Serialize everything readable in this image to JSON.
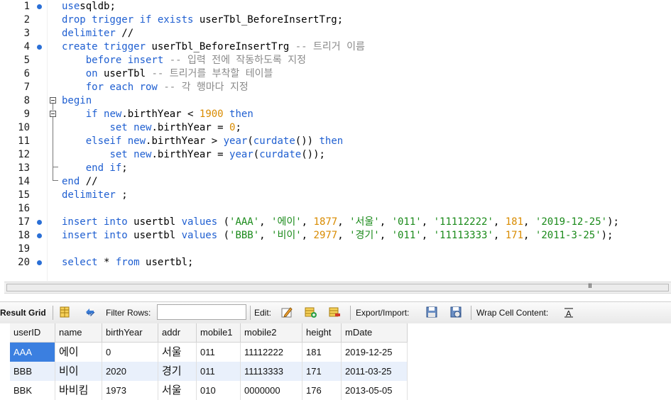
{
  "editor": {
    "lines": [
      {
        "n": "1",
        "bp": true,
        "tokens": [
          [
            "kw",
            "use"
          ],
          [
            "",
            "sqldb;"
          ]
        ]
      },
      {
        "n": "2",
        "bp": false,
        "tokens": [
          [
            "kw",
            "drop trigger if exists"
          ],
          [
            "",
            " userTbl_BeforeInsertTrg;"
          ]
        ]
      },
      {
        "n": "3",
        "bp": false,
        "tokens": [
          [
            "kw",
            "delimiter"
          ],
          [
            "",
            " //"
          ]
        ]
      },
      {
        "n": "4",
        "bp": true,
        "tokens": [
          [
            "kw",
            "create trigger"
          ],
          [
            "",
            " userTbl_BeforeInsertTrg "
          ],
          [
            "cm",
            "-- 트리거 이름"
          ]
        ]
      },
      {
        "n": "5",
        "bp": false,
        "tokens": [
          [
            "",
            "    "
          ],
          [
            "kw",
            "before insert"
          ],
          [
            "",
            " "
          ],
          [
            "cm",
            "-- 입력 전에 작동하도록 지정"
          ]
        ]
      },
      {
        "n": "6",
        "bp": false,
        "tokens": [
          [
            "",
            "    "
          ],
          [
            "kw",
            "on"
          ],
          [
            "",
            " userTbl "
          ],
          [
            "cm",
            "-- 트리거를 부착할 테이블"
          ]
        ]
      },
      {
        "n": "7",
        "bp": false,
        "tokens": [
          [
            "",
            "    "
          ],
          [
            "kw",
            "for each row"
          ],
          [
            "",
            " "
          ],
          [
            "cm",
            "-- 각 행마다 지정"
          ]
        ]
      },
      {
        "n": "8",
        "bp": false,
        "tokens": [
          [
            "kw",
            "begin"
          ]
        ]
      },
      {
        "n": "9",
        "bp": false,
        "tokens": [
          [
            "",
            "    "
          ],
          [
            "kw",
            "if"
          ],
          [
            "",
            " "
          ],
          [
            "kw",
            "new"
          ],
          [
            "",
            ".birthYear < "
          ],
          [
            "num",
            "1900"
          ],
          [
            "",
            " "
          ],
          [
            "kw",
            "then"
          ]
        ]
      },
      {
        "n": "10",
        "bp": false,
        "tokens": [
          [
            "",
            "        "
          ],
          [
            "kw",
            "set"
          ],
          [
            "",
            " "
          ],
          [
            "kw",
            "new"
          ],
          [
            "",
            ".birthYear = "
          ],
          [
            "num",
            "0"
          ],
          [
            "",
            ";"
          ]
        ]
      },
      {
        "n": "11",
        "bp": false,
        "tokens": [
          [
            "",
            "    "
          ],
          [
            "kw",
            "elseif"
          ],
          [
            "",
            " "
          ],
          [
            "kw",
            "new"
          ],
          [
            "",
            ".birthYear > "
          ],
          [
            "fn",
            "year"
          ],
          [
            "",
            "("
          ],
          [
            "fn",
            "curdate"
          ],
          [
            "",
            "()) "
          ],
          [
            "kw",
            "then"
          ]
        ]
      },
      {
        "n": "12",
        "bp": false,
        "tokens": [
          [
            "",
            "        "
          ],
          [
            "kw",
            "set"
          ],
          [
            "",
            " "
          ],
          [
            "kw",
            "new"
          ],
          [
            "",
            ".birthYear = "
          ],
          [
            "fn",
            "year"
          ],
          [
            "",
            "("
          ],
          [
            "fn",
            "curdate"
          ],
          [
            "",
            "());"
          ]
        ]
      },
      {
        "n": "13",
        "bp": false,
        "tokens": [
          [
            "",
            "    "
          ],
          [
            "kw",
            "end if"
          ],
          [
            "",
            ";"
          ]
        ]
      },
      {
        "n": "14",
        "bp": false,
        "tokens": [
          [
            "kw",
            "end"
          ],
          [
            "",
            " //"
          ]
        ]
      },
      {
        "n": "15",
        "bp": false,
        "tokens": [
          [
            "kw",
            "delimiter"
          ],
          [
            "",
            " ;"
          ]
        ]
      },
      {
        "n": "16",
        "bp": false,
        "tokens": []
      },
      {
        "n": "17",
        "bp": true,
        "tokens": [
          [
            "kw",
            "insert into"
          ],
          [
            "",
            " usertbl "
          ],
          [
            "kw",
            "values"
          ],
          [
            "",
            " ("
          ],
          [
            "str",
            "'AAA'"
          ],
          [
            "",
            ", "
          ],
          [
            "str",
            "'에이'"
          ],
          [
            "",
            ", "
          ],
          [
            "num",
            "1877"
          ],
          [
            "",
            ", "
          ],
          [
            "str",
            "'서울'"
          ],
          [
            "",
            ", "
          ],
          [
            "str",
            "'011'"
          ],
          [
            "",
            ", "
          ],
          [
            "str",
            "'11112222'"
          ],
          [
            "",
            ", "
          ],
          [
            "num",
            "181"
          ],
          [
            "",
            ", "
          ],
          [
            "str",
            "'2019-12-25'"
          ],
          [
            "",
            ");"
          ]
        ]
      },
      {
        "n": "18",
        "bp": true,
        "tokens": [
          [
            "kw",
            "insert into"
          ],
          [
            "",
            " usertbl "
          ],
          [
            "kw",
            "values"
          ],
          [
            "",
            " ("
          ],
          [
            "str",
            "'BBB'"
          ],
          [
            "",
            ", "
          ],
          [
            "str",
            "'비이'"
          ],
          [
            "",
            ", "
          ],
          [
            "num",
            "2977"
          ],
          [
            "",
            ", "
          ],
          [
            "str",
            "'경기'"
          ],
          [
            "",
            ", "
          ],
          [
            "str",
            "'011'"
          ],
          [
            "",
            ", "
          ],
          [
            "str",
            "'11113333'"
          ],
          [
            "",
            ", "
          ],
          [
            "num",
            "171"
          ],
          [
            "",
            ", "
          ],
          [
            "str",
            "'2011-3-25'"
          ],
          [
            "",
            ");"
          ]
        ]
      },
      {
        "n": "19",
        "bp": false,
        "tokens": []
      },
      {
        "n": "20",
        "bp": true,
        "tokens": [
          [
            "kw",
            "select"
          ],
          [
            "",
            " * "
          ],
          [
            "kw",
            "from"
          ],
          [
            "",
            " usertbl;"
          ]
        ]
      }
    ]
  },
  "scrollbar": {
    "grip": "III"
  },
  "toolbar": {
    "result_grid": "Result Grid",
    "filter_rows": "Filter Rows:",
    "filter_value": "",
    "edit": "Edit:",
    "export_import": "Export/Import:",
    "wrap_cell_content": "Wrap Cell Content:"
  },
  "grid": {
    "columns": [
      "userID",
      "name",
      "birthYear",
      "addr",
      "mobile1",
      "mobile2",
      "height",
      "mDate"
    ],
    "rows": [
      [
        "AAA",
        "에이",
        "0",
        "서울",
        "011",
        "11112222",
        "181",
        "2019-12-25"
      ],
      [
        "BBB",
        "비이",
        "2020",
        "경기",
        "011",
        "11113333",
        "171",
        "2011-03-25"
      ],
      [
        "BBK",
        "바비킴",
        "1973",
        "서울",
        "010",
        "0000000",
        "176",
        "2013-05-05"
      ]
    ]
  },
  "colors": {
    "keyword": "#1f5fd1",
    "comment": "#8a8a8a",
    "number": "#d98b00",
    "string": "#1a8a1a",
    "selection": "#3b7fe0",
    "breakpoint": "#2a6fd6"
  }
}
